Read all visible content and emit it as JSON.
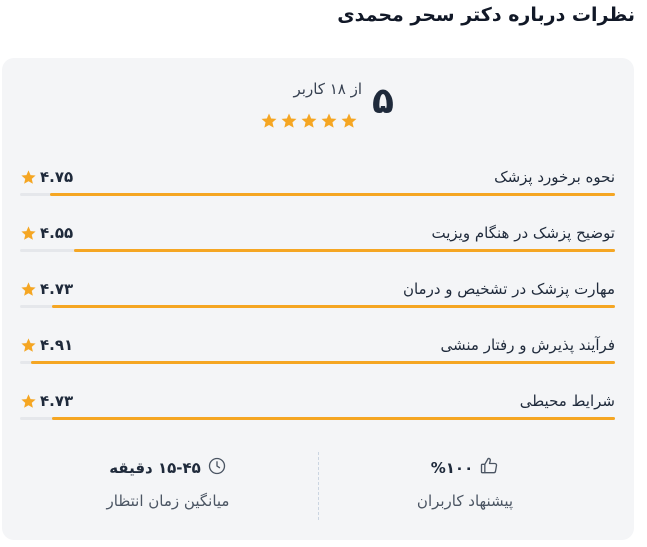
{
  "title": "نظرات درباره دکتر سحر محمدی",
  "summary": {
    "score": "۵",
    "count_text": "از ۱۸ کاربر",
    "stars_filled": 5,
    "star_color": "#f5a623"
  },
  "criteria": [
    {
      "label": "نحوه برخورد پزشک",
      "score": "۴.۷۵",
      "fraction": 0.95
    },
    {
      "label": "توضیح پزشک در هنگام ویزیت",
      "score": "۴.۵۵",
      "fraction": 0.91
    },
    {
      "label": "مهارت پزشک در تشخیص و درمان",
      "score": "۴.۷۳",
      "fraction": 0.946
    },
    {
      "label": "فرآیند پذیرش و رفتار منشی",
      "score": "۴.۹۱",
      "fraction": 0.982
    },
    {
      "label": "شرایط محیطی",
      "score": "۴.۷۳",
      "fraction": 0.946
    }
  ],
  "stats": {
    "recommend": {
      "value": "%۱۰۰",
      "label": "پیشنهاد کاربران",
      "icon": "thumbs-up-icon"
    },
    "wait_time": {
      "value": "۱۵-۴۵ دقیقه",
      "label": "میانگین زمان انتظار",
      "icon": "clock-icon"
    }
  },
  "colors": {
    "accent": "#f5a623",
    "card_bg": "#f4f5f7",
    "text": "#1f2a3b"
  }
}
